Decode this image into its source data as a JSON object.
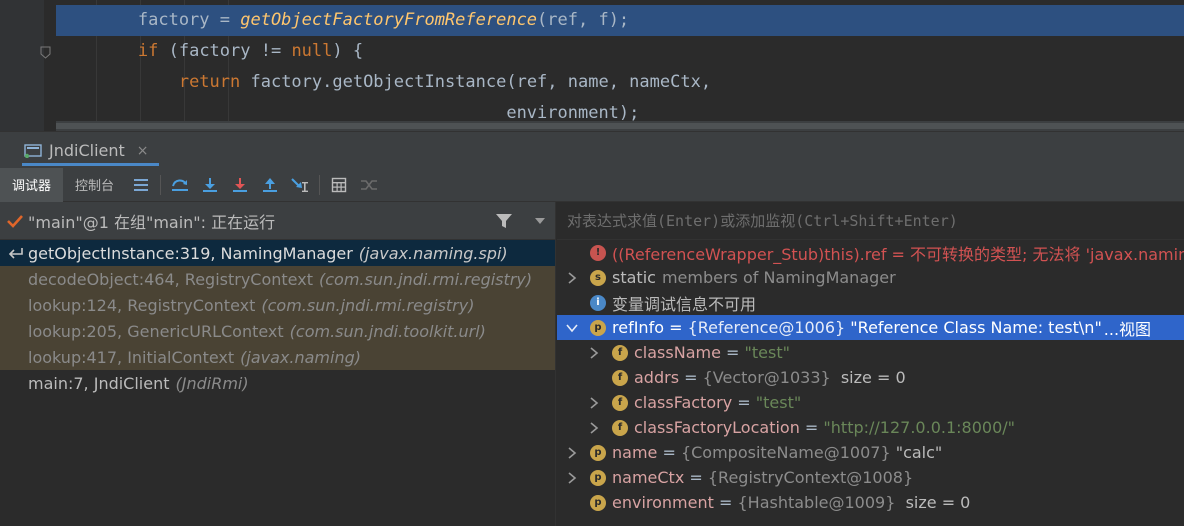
{
  "editor": {
    "lines": [
      {
        "pre": "        factory = ",
        "call": "getObjectFactoryFromReference",
        "post": "(ref, f);"
      },
      {
        "pre": "        ",
        "kw1": "if",
        "mid": " (factory != ",
        "kw2": "null",
        "post": ") {"
      },
      {
        "pre": "            ",
        "kw1": "return",
        "post": " factory.getObjectInstance(ref, name, nameCtx,"
      },
      {
        "pre": "                                            environment);"
      }
    ]
  },
  "toolwindow": {
    "tab_label": "JndiClient",
    "close_glyph": "×"
  },
  "toolbar": {
    "debugger_tab": "调试器",
    "console_tab": "控制台"
  },
  "thread": {
    "label": "\"main\"@1 在组\"main\": 正在运行"
  },
  "frames": [
    {
      "method": "getObjectInstance:319, NamingManager",
      "pkg": "(javax.naming.spi)",
      "kind": "selected"
    },
    {
      "method": "decodeObject:464, RegistryContext",
      "pkg": "(com.sun.jndi.rmi.registry)",
      "kind": "lib"
    },
    {
      "method": "lookup:124, RegistryContext",
      "pkg": "(com.sun.jndi.rmi.registry)",
      "kind": "lib"
    },
    {
      "method": "lookup:205, GenericURLContext",
      "pkg": "(com.sun.jndi.toolkit.url)",
      "kind": "lib"
    },
    {
      "method": "lookup:417, InitialContext",
      "pkg": "(javax.naming)",
      "kind": "lib"
    },
    {
      "method": "main:7, JndiClient",
      "pkg": "(JndiRmi)",
      "kind": "plain"
    }
  ],
  "watch": {
    "placeholder": "对表达式求值(Enter)或添加监视(Ctrl+Shift+Enter)"
  },
  "variables": {
    "error_row": "((ReferenceWrapper_Stub)this).ref = 不可转换的类型; 无法将 'javax.naming.s",
    "static_row": {
      "icon": "s",
      "kw": "static",
      "rest": "members of NamingManager"
    },
    "info_row": {
      "icon": "i",
      "text": "变量调试信息不可用"
    },
    "refinfo": {
      "icon": "p",
      "name": "refInfo",
      "eq": " = ",
      "type": "{Reference@1006}",
      "value": " \"Reference Class Name: test\\n\"",
      "link": "...视图"
    },
    "classname": {
      "icon": "f",
      "name": "className",
      "eq": " = ",
      "value": "\"test\""
    },
    "addrs": {
      "icon": "f",
      "name": "addrs",
      "eq": " = ",
      "type": "{Vector@1033}",
      "value": "  size = 0"
    },
    "classfactory": {
      "icon": "f",
      "name": "classFactory",
      "eq": " = ",
      "value": "\"test\""
    },
    "classfactorylocation": {
      "icon": "f",
      "name": "classFactoryLocation",
      "eq": " = ",
      "value": "\"http://127.0.0.1:8000/\""
    },
    "name": {
      "icon": "p",
      "name": "name",
      "eq": " = ",
      "type": "{CompositeName@1007}",
      "value": " \"calc\""
    },
    "namectx": {
      "icon": "p",
      "name": "nameCtx",
      "eq": " = ",
      "type": "{RegistryContext@1008}"
    },
    "environment": {
      "icon": "p",
      "name": "environment",
      "eq": " = ",
      "type": "{Hashtable@1009}",
      "value": "  size = 0"
    }
  },
  "colors": {
    "editor_bg": "#2b2b2b",
    "selection_blue": "#2f65ca",
    "library_frame_bg": "#4a4334",
    "keyword": "#cc7832",
    "method_italic": "#ffc66d",
    "string": "#6a8759",
    "error": "#d25252"
  }
}
